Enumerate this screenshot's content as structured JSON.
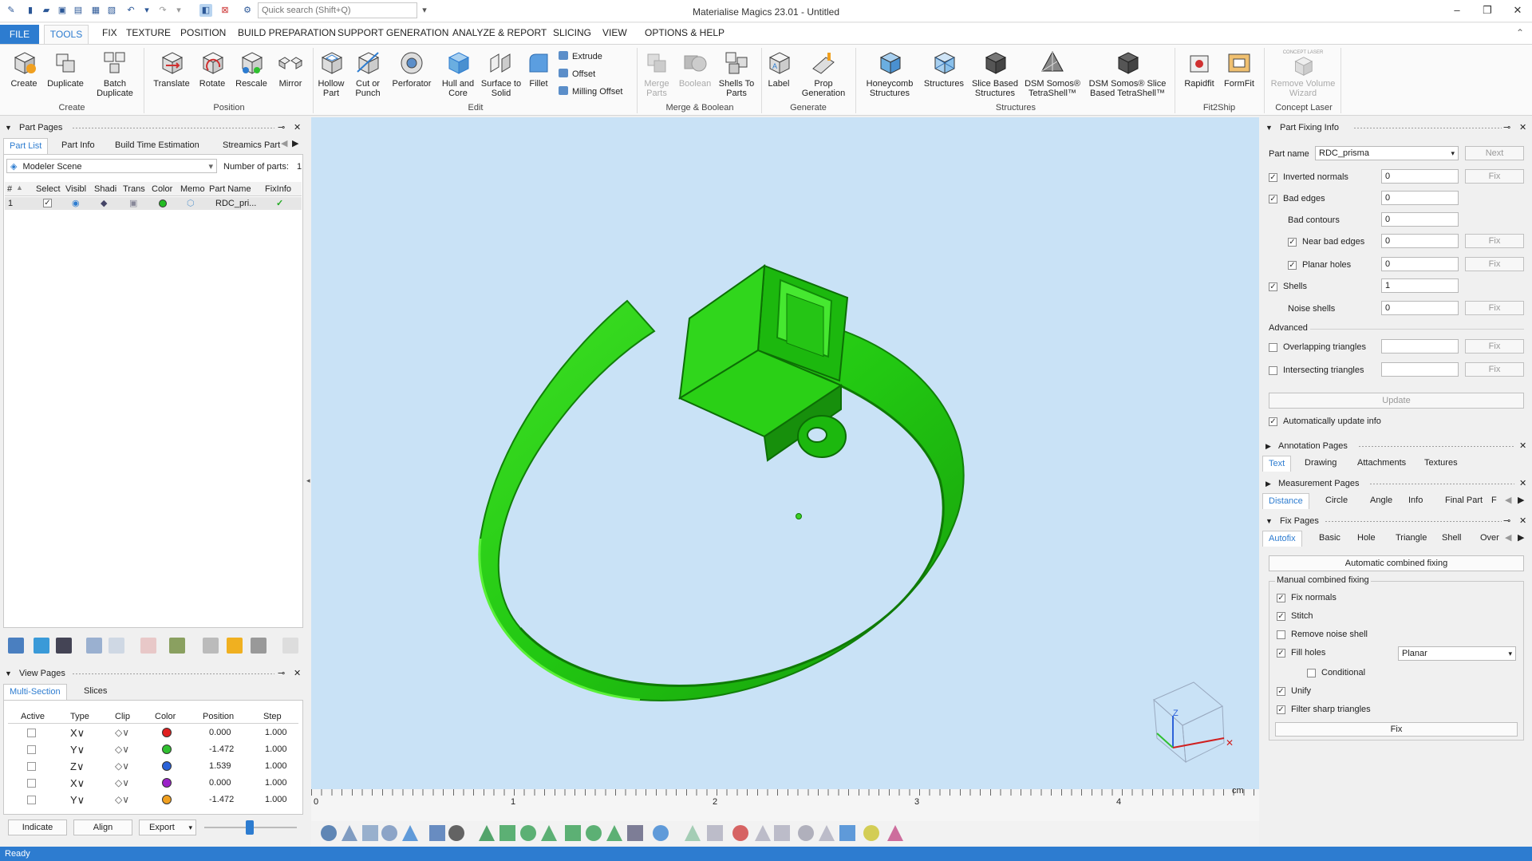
{
  "title_bar": {
    "app_title": "Materialise Magics 23.01 - Untitled",
    "search_placeholder": "Quick search (Shift+Q)",
    "minimize": "–",
    "maximize": "❐",
    "close": "✕"
  },
  "menu": {
    "file": "FILE",
    "tools": "TOOLS",
    "items": [
      "FIX",
      "TEXTURE",
      "POSITION",
      "BUILD PREPARATION",
      "SUPPORT GENERATION",
      "ANALYZE & REPORT",
      "SLICING",
      "VIEW",
      "OPTIONS & HELP"
    ]
  },
  "ribbon": {
    "create": {
      "group": "Create",
      "buttons": [
        "Create",
        "Duplicate",
        "Batch Duplicate"
      ]
    },
    "position": {
      "group": "Position",
      "buttons": [
        "Translate",
        "Rotate",
        "Rescale",
        "Mirror"
      ]
    },
    "edit": {
      "group": "Edit",
      "buttons": [
        "Hollow Part",
        "Cut or Punch",
        "Perforator",
        "Hull and Core",
        "Surface to Solid",
        "Fillet"
      ],
      "small": [
        "Extrude",
        "Offset",
        "Milling Offset"
      ]
    },
    "merge": {
      "group": "Merge & Boolean",
      "buttons": [
        "Merge Parts",
        "Boolean",
        "Shells To Parts"
      ]
    },
    "generate": {
      "group": "Generate",
      "buttons": [
        "Label",
        "Prop Generation"
      ]
    },
    "structures": {
      "group": "Structures",
      "buttons": [
        "Honeycomb Structures",
        "Structures",
        "Slice Based Structures",
        "DSM Somos® TetraShell™",
        "DSM Somos® Slice Based TetraShell™"
      ]
    },
    "fit2ship": {
      "group": "Fit2Ship",
      "buttons": [
        "Rapidfit",
        "FormFit"
      ]
    },
    "concept": {
      "group": "Concept Laser",
      "buttons": [
        "Remove Volume Wizard"
      ],
      "icon_caption": "CONCEPT LASER"
    }
  },
  "part_pages": {
    "title": "Part Pages",
    "tabs": [
      "Part List",
      "Part Info",
      "Build Time Estimation",
      "Streamics Part"
    ],
    "scene": "Modeler Scene",
    "num_parts_label": "Number of parts:",
    "num_parts": "1",
    "columns": [
      "#",
      "Select",
      "Visibl",
      "Shadi",
      "Trans",
      "Color",
      "Memo",
      "Part Name",
      "FixInfo"
    ],
    "row": {
      "num": "1",
      "name": "RDC_pri...",
      "fixinfo": "✓",
      "color": "#22bb22"
    }
  },
  "view_pages": {
    "title": "View Pages",
    "tabs": [
      "Multi-Section",
      "Slices"
    ],
    "columns": [
      "Active",
      "Type",
      "Clip",
      "Color",
      "Position",
      "Step"
    ],
    "rows": [
      {
        "type": "X∨",
        "color": "#e02020",
        "position": "0.000",
        "step": "1.000"
      },
      {
        "type": "Y∨",
        "color": "#30c030",
        "position": "-1.472",
        "step": "1.000"
      },
      {
        "type": "Z∨",
        "color": "#2a62d8",
        "position": "1.539",
        "step": "1.000"
      },
      {
        "type": "X∨",
        "color": "#9b22c8",
        "position": "0.000",
        "step": "1.000"
      },
      {
        "type": "Y∨",
        "color": "#f0a020",
        "position": "-1.472",
        "step": "1.000"
      }
    ],
    "buttons": {
      "indicate": "Indicate",
      "align": "Align",
      "export": "Export"
    }
  },
  "viewport": {
    "ruler_ticks": [
      "0",
      "1",
      "2",
      "3",
      "4"
    ],
    "unit": "cm",
    "model_color": "#22cc11",
    "background": "#c9e2f6"
  },
  "part_fixing": {
    "title": "Part Fixing Info",
    "part_name_label": "Part name",
    "part_name": "RDC_prisma",
    "next": "Next",
    "fix": "Fix",
    "rows": [
      {
        "label": "Inverted normals",
        "value": "0",
        "checked": true
      },
      {
        "label": "Bad edges",
        "value": "0",
        "checked": true
      },
      {
        "label": "Bad contours",
        "value": "0"
      },
      {
        "label": "Near bad edges",
        "value": "0",
        "checked": true
      },
      {
        "label": "Planar holes",
        "value": "0",
        "checked": true
      },
      {
        "label": "Shells",
        "value": "1",
        "checked": true
      },
      {
        "label": "Noise shells",
        "value": "0"
      }
    ],
    "advanced": "Advanced",
    "overlapping": "Overlapping triangles",
    "intersecting": "Intersecting triangles",
    "update": "Update",
    "auto_update": "Automatically update info"
  },
  "annotation": {
    "title": "Annotation Pages",
    "tabs": [
      "Text",
      "Drawing",
      "Attachments",
      "Textures"
    ]
  },
  "measurement": {
    "title": "Measurement Pages",
    "tabs": [
      "Distance",
      "Circle",
      "Angle",
      "Info",
      "Final Part",
      "F"
    ]
  },
  "fix_pages": {
    "title": "Fix Pages",
    "tabs": [
      "Autofix",
      "Basic",
      "Hole",
      "Triangle",
      "Shell",
      "Over"
    ],
    "auto_btn": "Automatic combined fixing",
    "manual_label": "Manual combined fixing",
    "options": [
      "Fix normals",
      "Stitch",
      "Remove noise shell",
      "Fill holes",
      "Conditional",
      "Unify",
      "Filter sharp triangles"
    ],
    "fill_mode": "Planar",
    "fix_btn": "Fix"
  },
  "status": "Ready"
}
